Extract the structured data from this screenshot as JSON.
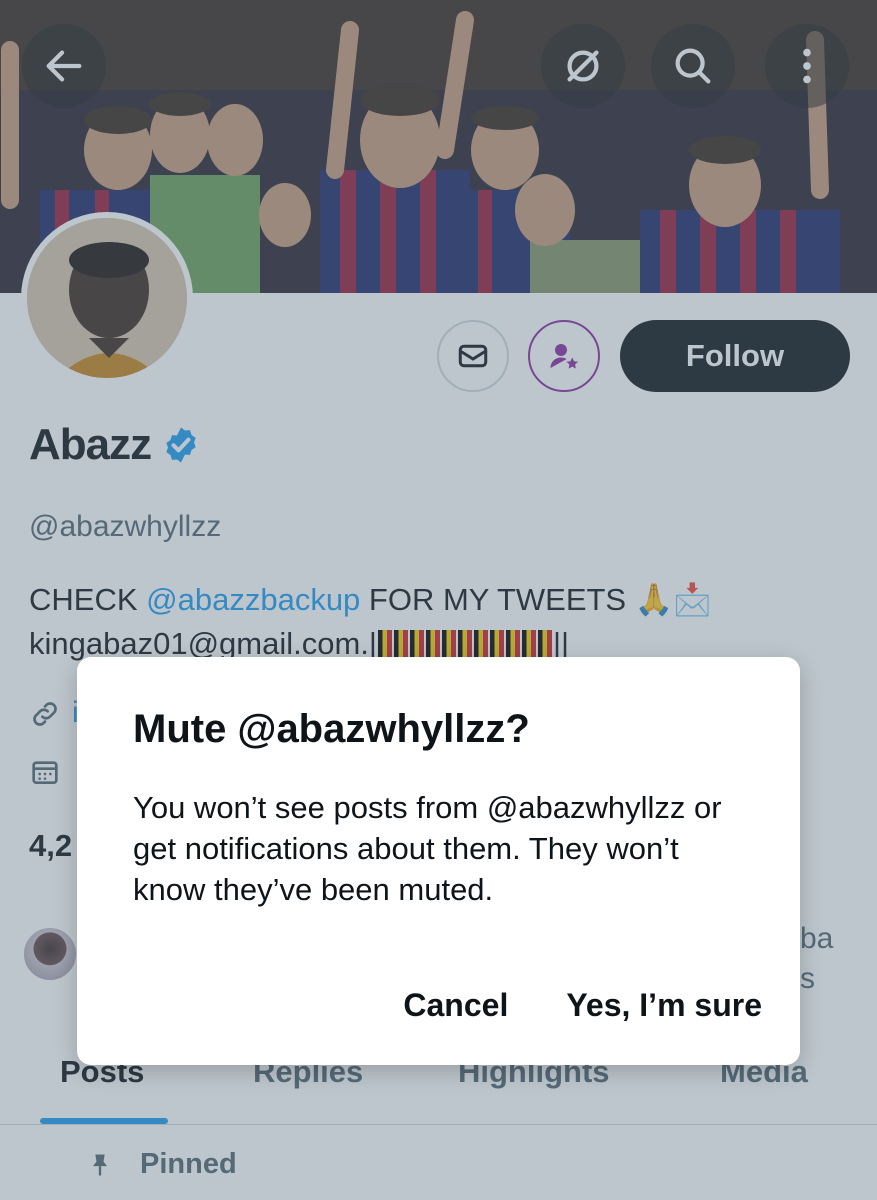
{
  "profile": {
    "name": "Abazz",
    "handle": "@abazwhyllzz",
    "bio_prefix": "CHECK ",
    "bio_mention": "@abazzbackup",
    "bio_suffix": " FOR MY TWEETS 🙏📩",
    "bio_email": "kingabaz01@gmail.com.|",
    "bio_end": "||",
    "link_fragment": "i",
    "stat_fragment": "4,2",
    "followed_by_fragment_1": "ba",
    "followed_by_fragment_2": "s"
  },
  "header": {
    "back_icon": "arrow-left-icon",
    "grok_icon": "grok-icon",
    "search_icon": "search-icon",
    "more_icon": "more-vertical-icon"
  },
  "actions": {
    "follow_label": "Follow",
    "message_icon": "envelope-icon",
    "subscribe_icon": "person-star-icon"
  },
  "tabs": [
    {
      "label": "Posts"
    },
    {
      "label": "Replies"
    },
    {
      "label": "Highlights"
    },
    {
      "label": "Media"
    }
  ],
  "pinned_label": "Pinned",
  "dialog": {
    "title": "Mute @abazwhyllzz?",
    "body": "You won’t see posts from @abazwhyllzz or get notifications about them. They won’t know they’ve been muted.",
    "cancel_label": "Cancel",
    "confirm_label": "Yes, I’m sure"
  },
  "colors": {
    "accent": "#1d9bf0",
    "subscribe_purple": "#8e2ea0",
    "text_primary": "#0f1419",
    "text_secondary": "#536471"
  }
}
